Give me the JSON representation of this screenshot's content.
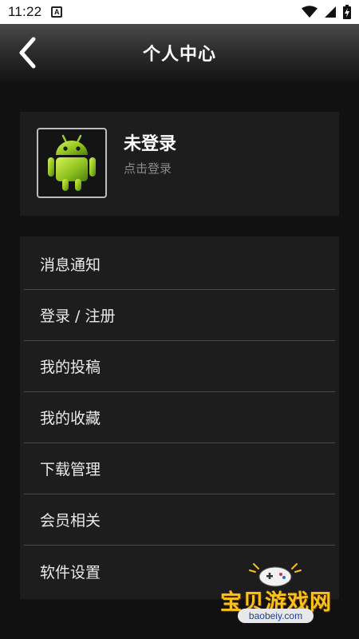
{
  "status_bar": {
    "time": "11:22",
    "notification_badge": "A",
    "icons": [
      "wifi-icon",
      "cell-signal-icon",
      "battery-charging-icon"
    ]
  },
  "header": {
    "title": "个人中心",
    "back_icon": "chevron-left-icon"
  },
  "profile": {
    "avatar_icon": "android-robot-icon",
    "name": "未登录",
    "subtitle": "点击登录"
  },
  "menu": {
    "items": [
      {
        "label": "消息通知"
      },
      {
        "label": "登录 / 注册"
      },
      {
        "label": "我的投稿"
      },
      {
        "label": "我的收藏"
      },
      {
        "label": "下载管理"
      },
      {
        "label": "会员相关"
      },
      {
        "label": "软件设置"
      }
    ]
  },
  "watermark": {
    "text": "宝贝游戏网",
    "url": "baobeiy.com"
  },
  "colors": {
    "background": "#111111",
    "card": "#1d1d1d",
    "divider": "#4a4a4a",
    "watermark_text": "#f7c21d"
  }
}
